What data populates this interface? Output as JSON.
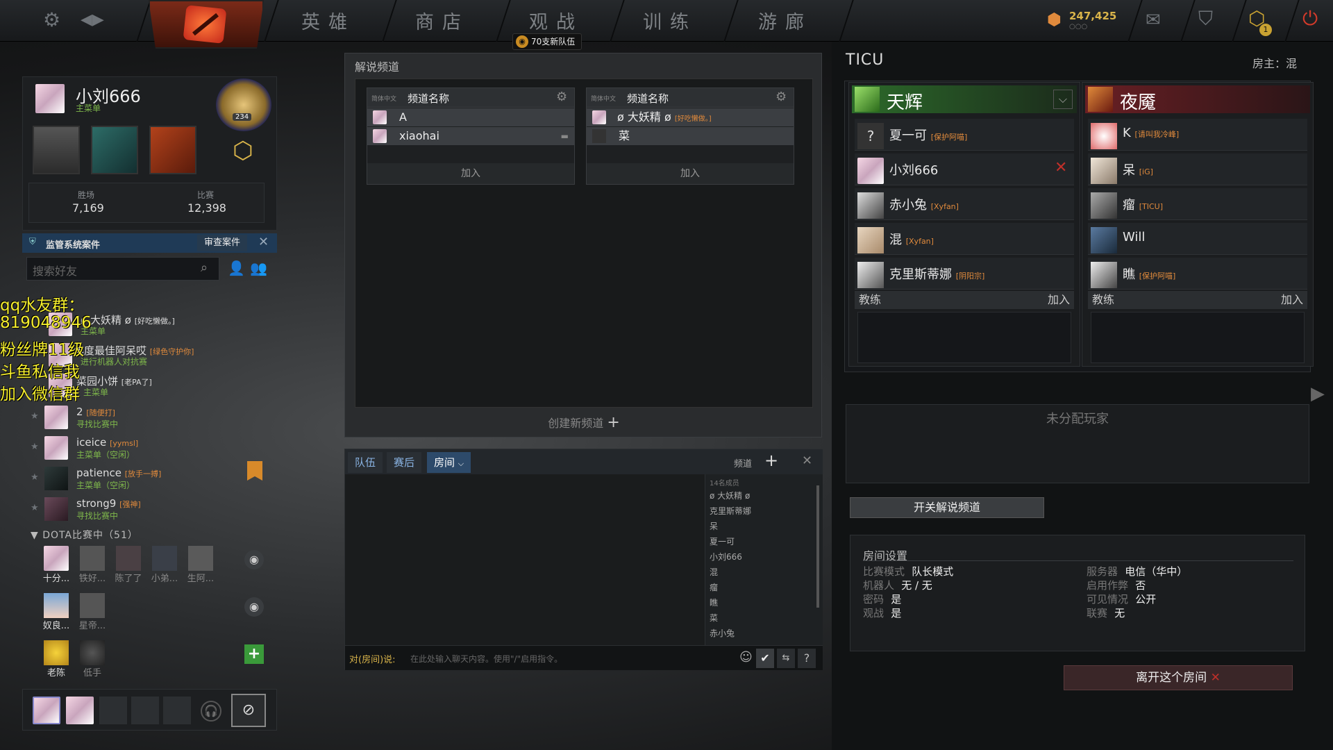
{
  "topbar": {
    "nav": [
      "英雄",
      "商店",
      "观战",
      "训练",
      "游廊"
    ],
    "team_badge": "70支新队伍",
    "currency": "247,425",
    "currency_sub": "○○○",
    "notification_count": "1"
  },
  "profile": {
    "name": "小刘666",
    "status": "主菜单",
    "rank_number": "234",
    "wins_label": "胜场",
    "wins": "7,169",
    "matches_label": "比赛",
    "matches": "12,398"
  },
  "overwatch": {
    "title": "监管系统案件",
    "button": "审查案件"
  },
  "friends_search": {
    "placeholder": "搜索好友"
  },
  "stream_overlay": [
    "qq水友群：",
    "819048946",
    "粉丝牌11级",
    "斗鱼私信我",
    "加入微信群"
  ],
  "friends": [
    {
      "name": "ø 大妖精 ø",
      "tag": "[好吃懒做。]",
      "status": "主菜单",
      "status_color": "#7fb84b"
    },
    {
      "name": "年度最佳阿呆哎",
      "tag": "[绿色守护你]",
      "status": "进行机器人对抗赛",
      "status_color": "#7fb84b"
    },
    {
      "name": "菜园小饼",
      "tag": "[老PA了]",
      "status": "主菜单",
      "status_color": "#7fb84b"
    },
    {
      "name": "2",
      "tag": "[随便打]",
      "status": "寻找比赛中",
      "status_color": "#7fb84b"
    },
    {
      "name": "iceice",
      "tag": "[yymsl]",
      "status": "主菜单（空闲）",
      "status_color": "#7fb84b"
    },
    {
      "name": "patience",
      "tag": "[放手一搏]",
      "status": "主菜单（空闲）",
      "status_color": "#7fb84b"
    },
    {
      "name": "strong9",
      "tag": "[强神]",
      "status": "寻找比赛中",
      "status_color": "#7fb84b"
    }
  ],
  "in_game": {
    "header": "DOTA比赛中（51）",
    "row1": [
      "十分...",
      "铁好...",
      "陈了了",
      "小弟...",
      "生阿..."
    ],
    "row2": [
      "奴良...",
      "星帝..."
    ],
    "row3": [
      "老陈",
      "低手"
    ]
  },
  "broadcast": {
    "title": "解说频道",
    "channels": [
      {
        "lang": "简体中文",
        "name": "频道名称",
        "members": [
          "A",
          "xiaohai"
        ],
        "join": "加入"
      },
      {
        "lang": "简体中文",
        "name": "频道名称",
        "members": [
          "ø 大妖精 ø",
          "菜"
        ],
        "member_tags": [
          "[好吃懒做。]",
          ""
        ],
        "join": "加入"
      }
    ],
    "create": "创建新频道"
  },
  "chat": {
    "tabs": [
      "队伍",
      "赛后",
      "房间"
    ],
    "channels_label": "频道",
    "member_count": "14名成员",
    "members": [
      "ø 大妖精 ø",
      "克里斯蒂娜",
      "呆",
      "夏一可",
      "小刘666",
      "混",
      "瘤",
      "瞧",
      "菜",
      "赤小兔"
    ],
    "input_prefix": "对(房间)说:",
    "input_placeholder": "在此处输入聊天内容。使用\"/\"启用指令。"
  },
  "lobby": {
    "name": "TICU",
    "host": "房主：混",
    "radiant": {
      "name": "天辉",
      "players": [
        {
          "name": "夏一可",
          "tag": "[保护阿喵]"
        },
        {
          "name": "小刘666",
          "tag": ""
        },
        {
          "name": "赤小兔",
          "tag": "[Xyfan]"
        },
        {
          "name": "混",
          "tag": "[Xyfan]"
        },
        {
          "name": "克里斯蒂娜",
          "tag": "[阴阳宗]"
        }
      ]
    },
    "dire": {
      "name": "夜魇",
      "players": [
        {
          "name": "K",
          "tag": "[请叫我冷峰]"
        },
        {
          "name": "呆",
          "tag": "[iG]"
        },
        {
          "name": "瘤",
          "tag": "[TICU]"
        },
        {
          "name": "Will",
          "tag": ""
        },
        {
          "name": "瞧",
          "tag": "[保护阿喵]"
        }
      ]
    },
    "coach_label": "教练",
    "join_label": "加入",
    "unassigned": "未分配玩家",
    "toggle_broadcast": "开关解说频道",
    "settings_title": "房间设置",
    "settings_left": [
      {
        "k": "比赛模式",
        "v": "队长模式"
      },
      {
        "k": "机器人",
        "v": "无 / 无"
      },
      {
        "k": "密码",
        "v": "是"
      },
      {
        "k": "观战",
        "v": "是"
      }
    ],
    "settings_right": [
      {
        "k": "服务器",
        "v": "电信（华中）"
      },
      {
        "k": "启用作弊",
        "v": "否"
      },
      {
        "k": "可见情况",
        "v": "公开"
      },
      {
        "k": "联赛",
        "v": "无"
      }
    ],
    "leave": "离开这个房间"
  }
}
